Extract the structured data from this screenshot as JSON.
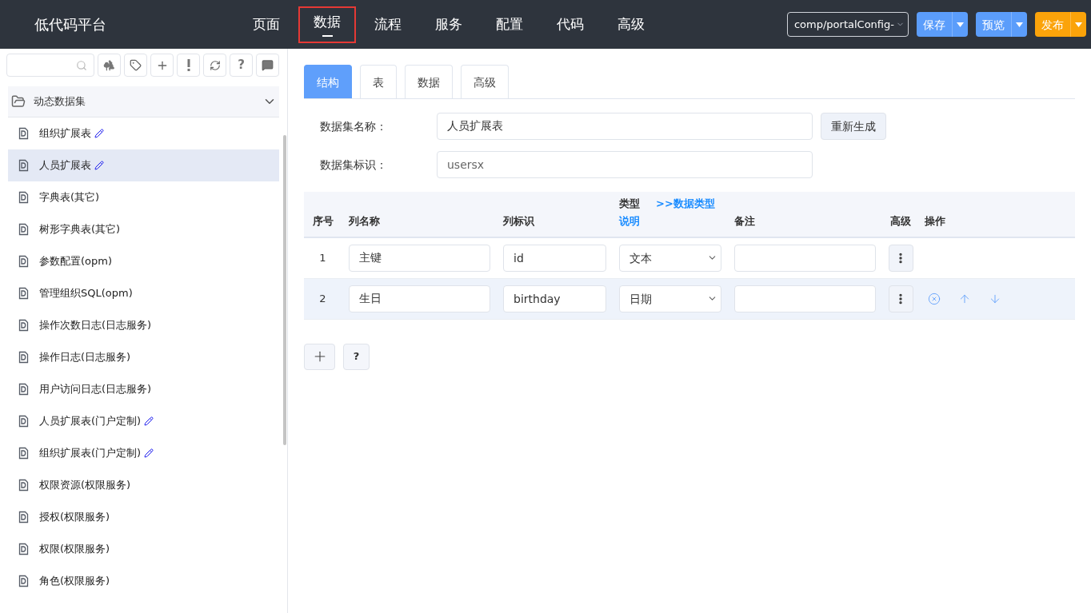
{
  "header": {
    "title": "低代码平台",
    "nav": [
      {
        "label": "页面",
        "selected": false
      },
      {
        "label": "数据",
        "selected": true
      },
      {
        "label": "流程",
        "selected": false
      },
      {
        "label": "服务",
        "selected": false
      },
      {
        "label": "配置",
        "selected": false
      },
      {
        "label": "代码",
        "selected": false
      },
      {
        "label": "高级",
        "selected": false
      }
    ],
    "component_select": "comp/portalConfig-",
    "buttons": [
      {
        "label": "保存",
        "kind": "primary"
      },
      {
        "label": "预览",
        "kind": "primary"
      },
      {
        "label": "发布",
        "kind": "warning"
      }
    ]
  },
  "sidebar": {
    "toolbar_help": "?",
    "section": {
      "title": "动态数据集",
      "expanded": true
    },
    "items": [
      {
        "label": "组织扩展表",
        "edited": true,
        "selected": false
      },
      {
        "label": "人员扩展表",
        "edited": true,
        "selected": true
      },
      {
        "label": "字典表(其它)",
        "edited": false,
        "selected": false
      },
      {
        "label": "树形字典表(其它)",
        "edited": false,
        "selected": false
      },
      {
        "label": "参数配置(opm)",
        "edited": false,
        "selected": false
      },
      {
        "label": "管理组织SQL(opm)",
        "edited": false,
        "selected": false
      },
      {
        "label": "操作次数日志(日志服务)",
        "edited": false,
        "selected": false
      },
      {
        "label": "操作日志(日志服务)",
        "edited": false,
        "selected": false
      },
      {
        "label": "用户访问日志(日志服务)",
        "edited": false,
        "selected": false
      },
      {
        "label": "人员扩展表(门户定制)",
        "edited": true,
        "selected": false
      },
      {
        "label": "组织扩展表(门户定制)",
        "edited": true,
        "selected": false
      },
      {
        "label": "权限资源(权限服务)",
        "edited": false,
        "selected": false
      },
      {
        "label": "授权(权限服务)",
        "edited": false,
        "selected": false
      },
      {
        "label": "权限(权限服务)",
        "edited": false,
        "selected": false
      },
      {
        "label": "角色(权限服务)",
        "edited": false,
        "selected": false
      }
    ]
  },
  "tabs": [
    {
      "label": "结构",
      "selected": true
    },
    {
      "label": "表",
      "selected": false
    },
    {
      "label": "数据",
      "selected": false
    },
    {
      "label": "高级",
      "selected": false
    }
  ],
  "form": {
    "name_label": "数据集名称：",
    "name_value": "人员扩展表",
    "regenerate": "重新生成",
    "id_label": "数据集标识：",
    "id_value": "usersx"
  },
  "table": {
    "columns": {
      "index": "序号",
      "name": "列名称",
      "ident": "列标识",
      "type": "类型",
      "type_link": ">>数据类型",
      "type_desc": "说明",
      "note": "备注",
      "advanced": "高级",
      "ops": "操作"
    },
    "rows": [
      {
        "index": "1",
        "name": "主键",
        "ident": "id",
        "type": "文本",
        "note": "",
        "actions": false
      },
      {
        "index": "2",
        "name": "生日",
        "ident": "birthday",
        "type": "日期",
        "note": "",
        "actions": true
      }
    ]
  },
  "footer": {
    "help": "?"
  }
}
